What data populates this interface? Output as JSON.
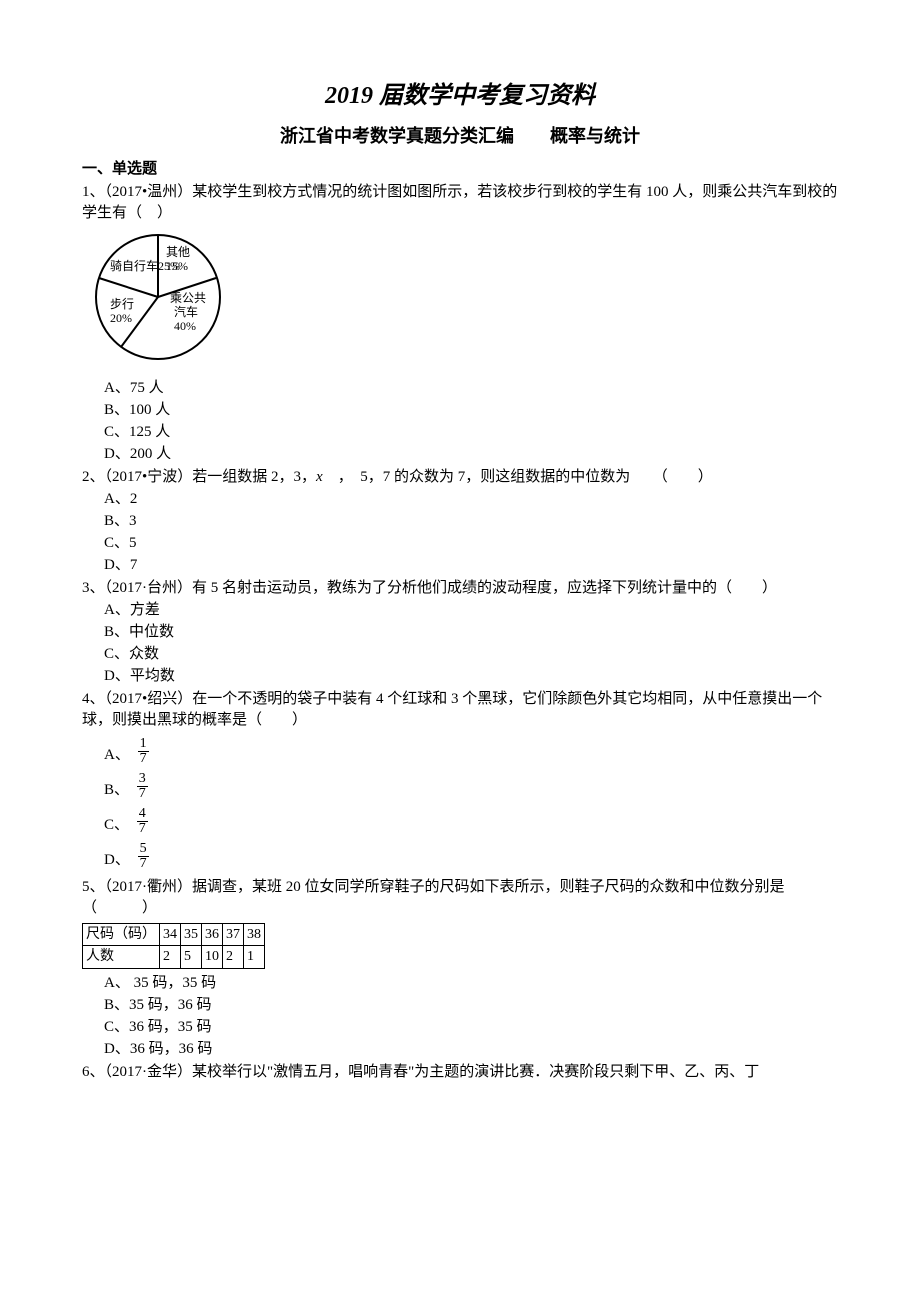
{
  "title_main": "2019 届数学中考复习资料",
  "title_sub": "浙江省中考数学真题分类汇编　　概率与统计",
  "section1": "一、单选题",
  "q1": {
    "stem": "1、（2017•温州）某校学生到校方式情况的统计图如图所示，若该校步行到校的学生有 100 人，则乘公共汽车到校的学生有（　）",
    "pie": {
      "bike": "骑自行车25%",
      "other_l1": "其他",
      "other_l2": "15%",
      "walk_l1": "步行",
      "walk_l2": "20%",
      "bus_l1": "乘公共",
      "bus_l2": "汽车",
      "bus_l3": "40%"
    },
    "A": "A、75 人",
    "B": "B、100 人",
    "C": "C、125 人",
    "D": "D、200 人"
  },
  "q2": {
    "stem_a": "2、（2017•宁波）若一组数据 2，3，",
    "x": "x",
    "stem_b": "　，　5，7 的众数为 7，则这组数据的中位数为　　（　　）",
    "A": "A、2",
    "B": "B、3",
    "C": "C、5",
    "D": "D、7"
  },
  "q3": {
    "stem": "3、（2017·台州）有 5 名射击运动员，教练为了分析他们成绩的波动程度，应选择下列统计量中的（　　）",
    "A": "A、方差",
    "B": "B、中位数",
    "C": "C、众数",
    "D": "D、平均数"
  },
  "q4": {
    "stem": "4、（2017•绍兴）在一个不透明的袋子中装有 4 个红球和 3 个黑球，它们除颜色外其它均相同，从中任意摸出一个球，则摸出黑球的概率是（　　）",
    "A_letter": "A、",
    "A_num": "1",
    "A_den": "7",
    "B_letter": "B、",
    "B_num": "3",
    "B_den": "7",
    "C_letter": "C、",
    "C_num": "4",
    "C_den": "7",
    "D_letter": "D、",
    "D_num": "5",
    "D_den": "7"
  },
  "q5": {
    "stem": "5、（2017·衢州）据调查，某班 20 位女同学所穿鞋子的尺码如下表所示，则鞋子尺码的众数和中位数分别是（　　　）",
    "th_size": "尺码（码）",
    "th_count": "人数",
    "sizes": [
      "34",
      "35",
      "36",
      "37",
      "38"
    ],
    "counts": [
      "2",
      "5",
      "10",
      "2",
      "1"
    ],
    "A": "A、 35 码，35 码",
    "B": "B、35 码，36 码",
    "C": "C、36 码，35 码",
    "D": "D、36 码，36 码"
  },
  "q6": {
    "stem": "6、（2017·金华）某校举行以\"激情五月，唱响青春\"为主题的演讲比赛．决赛阶段只剩下甲、乙、丙、丁"
  },
  "chart_data": {
    "type": "pie",
    "title": "",
    "categories": [
      "骑自行车",
      "其他",
      "乘公共汽车",
      "步行"
    ],
    "values": [
      25,
      15,
      40,
      20
    ],
    "unit": "%"
  }
}
